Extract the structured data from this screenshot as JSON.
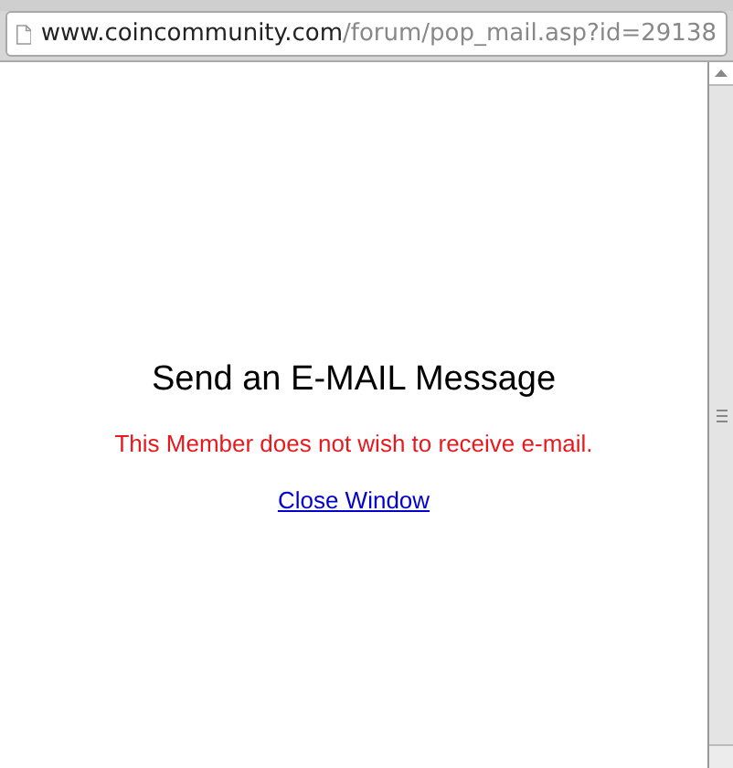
{
  "address_bar": {
    "host": "www.coincommunity.com",
    "path": "/forum/pop_mail.asp?id=29138"
  },
  "page": {
    "heading": "Send an E-MAIL Message",
    "notice": "This Member does not wish to receive e-mail.",
    "link": "Close Window"
  }
}
